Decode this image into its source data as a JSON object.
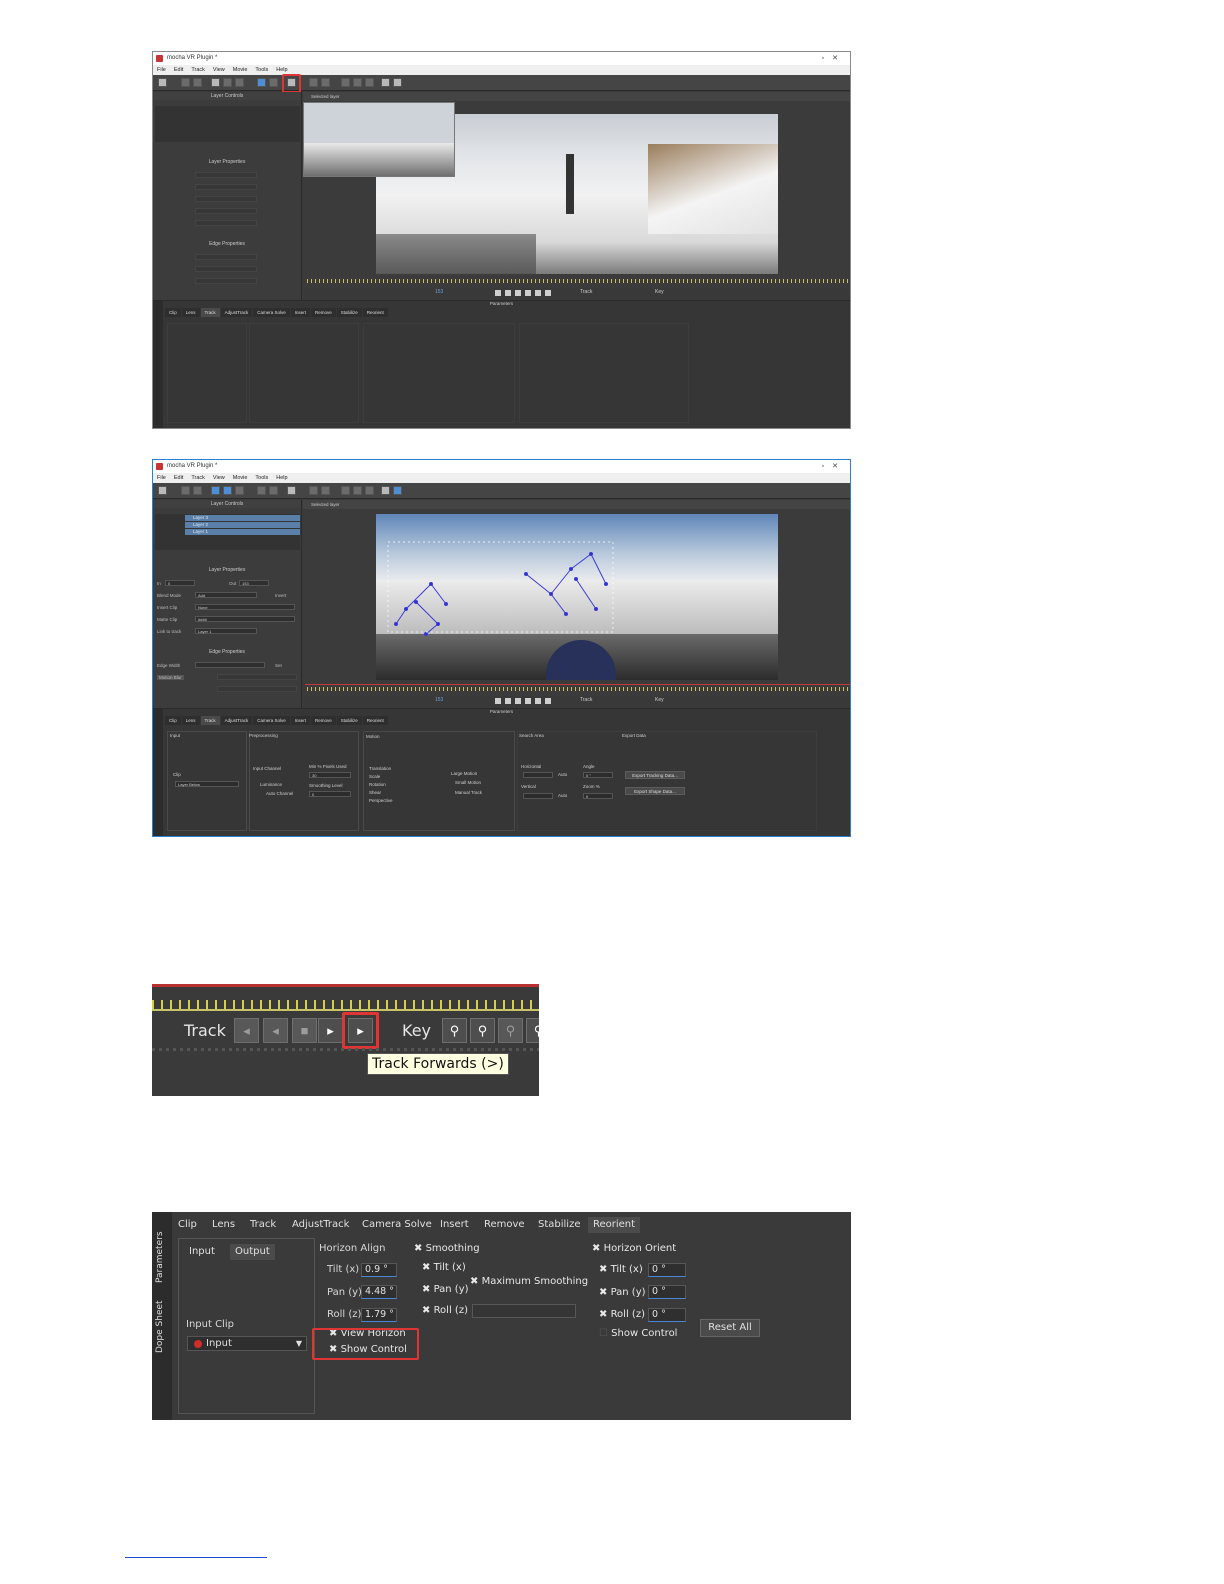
{
  "window1": {
    "title": "mocha VR Plugin *",
    "menu": [
      "File",
      "Edit",
      "Track",
      "View",
      "Movie",
      "Tools",
      "Help"
    ],
    "layer_controls_title": "Layer Controls",
    "layer_properties_title": "Layer Properties",
    "edge_properties_title": "Edge Properties",
    "selected_layer": "Selected layer",
    "parameters_title": "Parameters",
    "tabs": [
      "Clip",
      "Lens",
      "Track",
      "AdjustTrack",
      "Camera Solve",
      "Insert",
      "Remove",
      "Stabilize",
      "Reorient"
    ],
    "active_tab": "Track",
    "vertical_tabs": [
      "Parameters",
      "Dope Sheet"
    ],
    "transport_track": "Track",
    "transport_key": "Key",
    "frame_field": "153"
  },
  "window2": {
    "title": "mocha VR Plugin *",
    "menu": [
      "File",
      "Edit",
      "Track",
      "View",
      "Movie",
      "Tools",
      "Help"
    ],
    "layer_controls_title": "Layer Controls",
    "layers": [
      "Layer 3",
      "Layer 2",
      "Layer 1"
    ],
    "layer_properties_title": "Layer Properties",
    "in_label": "In",
    "in_value": "0",
    "out_label": "Out",
    "out_value": "153",
    "blend_mode_label": "Blend Mode",
    "blend_mode_value": "Add",
    "invert_label": "Invert",
    "insert_clip_label": "Insert Clip",
    "insert_clip_value": "None",
    "matte_clip_label": "Matte Clip",
    "matte_clip_value": "####",
    "link_to_track_label": "Link to track",
    "link_to_track_value": "Layer 1",
    "edge_properties_title": "Edge Properties",
    "edge_width_label": "Edge Width",
    "set_label": "Set",
    "motion_blur_label": "Motion Blur",
    "selected_layer": "Selected layer",
    "parameters_title": "Parameters",
    "tabs": [
      "Clip",
      "Lens",
      "Track",
      "AdjustTrack",
      "Camera Solve",
      "Insert",
      "Remove",
      "Stabilize",
      "Reorient"
    ],
    "active_tab": "Track",
    "vertical_tabs": [
      "Parameters",
      "Dope Sheet"
    ],
    "input_section": "Input",
    "clip_label": "Clip",
    "clip_value": "Layer Below",
    "preprocessing_section": "Preprocessing",
    "input_channel_label": "Input Channel",
    "luminance_label": "Luminance",
    "auto_channel_label": "Auto Channel",
    "min_pixels_label": "Min % Pixels Used",
    "min_pixels_value": "30",
    "smoothing_level_label": "Smoothing Level",
    "smoothing_level_value": "0",
    "motion_section": "Motion",
    "motion_options": [
      "Translation",
      "Scale",
      "Rotation",
      "Shear",
      "Perspective"
    ],
    "large_motion": "Large Motion",
    "small_motion": "Small Motion",
    "manual_track": "Manual Track",
    "search_area_section": "Search Area",
    "horizontal_label": "Horizontal",
    "vertical_label": "Vertical",
    "auto_label": "Auto",
    "angle_label": "Angle",
    "angle_value": "0 °",
    "zoom_label": "Zoom %",
    "zoom_value": "0",
    "export_section": "Export Data",
    "export_tracking": "Export Tracking Data...",
    "export_shape": "Export Shape Data...",
    "transport_track": "Track",
    "transport_key": "Key",
    "frame_field": "153"
  },
  "crop3": {
    "track_label": "Track",
    "key_label": "Key",
    "tooltip": "Track Forwards (>)"
  },
  "crop4": {
    "vertical_tabs": [
      "Parameters",
      "Dope Sheet"
    ],
    "tabs": [
      "Clip",
      "Lens",
      "Track",
      "AdjustTrack",
      "Camera Solve",
      "Insert",
      "Remove",
      "Stabilize",
      "Reorient"
    ],
    "active_tab": "Reorient",
    "input_tab": "Input",
    "output_tab": "Output",
    "input_clip_label": "Input Clip",
    "input_clip_value": "Input",
    "horizon_align_label": "Horizon Align",
    "tilt_label": "Tilt (x)",
    "tilt_value": "0.9 °",
    "pan_label": "Pan (y)",
    "pan_value": "4.48 °",
    "roll_label": "Roll (z)",
    "roll_value": "1.79 °",
    "view_horizon": "View Horizon",
    "show_control": "Show Control",
    "smoothing_label": "Smoothing",
    "smooth_tilt": "Tilt (x)",
    "smooth_pan": "Pan (y)",
    "smooth_roll": "Roll (z)",
    "maximum_smoothing": "Maximum Smoothing",
    "horizon_orient_label": "Horizon Orient",
    "orient_tilt": "Tilt (x)",
    "orient_tilt_value": "0 °",
    "orient_pan": "Pan (y)",
    "orient_pan_value": "0 °",
    "orient_roll": "Roll (z)",
    "orient_roll_value": "0 °",
    "orient_show_control": "Show Control",
    "reset_all": "Reset All"
  },
  "colors": {
    "highlight": "#e03535",
    "panel": "#3a3a3a",
    "accent_blue": "#4a86d4"
  }
}
